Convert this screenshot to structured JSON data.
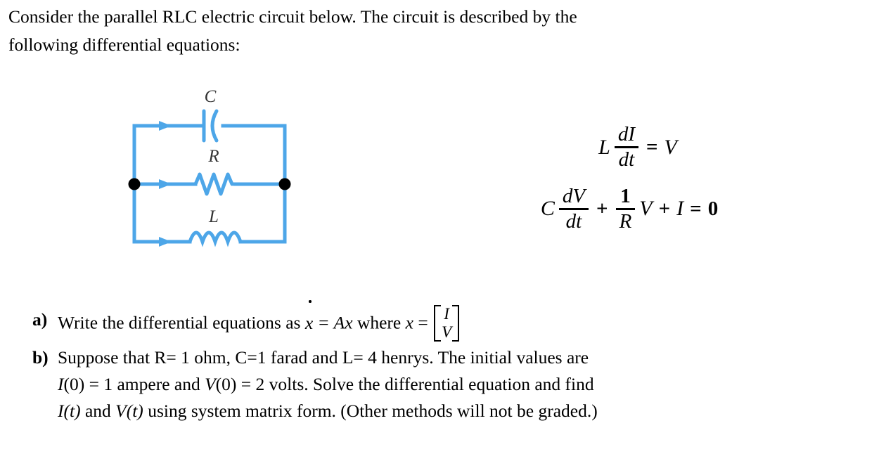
{
  "intro": {
    "line1": "Consider the parallel RLC electric circuit below. The circuit is described by the",
    "line2": "following differential equations:"
  },
  "circuit": {
    "title": "parallel-rlc-circuit",
    "wire_color": "#4da6e8",
    "node_color": "#000000",
    "components": [
      {
        "id": "capacitor",
        "label": "C",
        "branch": "top"
      },
      {
        "id": "resistor",
        "label": "R",
        "branch": "middle"
      },
      {
        "id": "inductor",
        "label": "L",
        "branch": "bottom"
      }
    ],
    "labels": {
      "capacitor": "C",
      "resistor": "R",
      "inductor": "L"
    },
    "current_arrows": 3,
    "junction_dots": 2
  },
  "equations": {
    "eq1": {
      "lhs_coefficient": "L",
      "numerator": "dI",
      "denominator": "dt",
      "relation": "=",
      "rhs": "V"
    },
    "eq2": {
      "term1_coefficient": "C",
      "term1_numerator": "dV",
      "term1_denominator": "dt",
      "plus1": "+",
      "term2_numerator": "1",
      "term2_denominator": "R",
      "term2_variable": "V",
      "plus2": "+",
      "term3": "I",
      "relation": "=",
      "rhs": "0"
    }
  },
  "questions": [
    {
      "marker": "a)",
      "text_before": "Write the differential equations as",
      "xdot": "x",
      "equals_ax": "= Ax",
      "text_mid": "where",
      "x_var": "x",
      "equals": "=",
      "matrix_top": "I",
      "matrix_bottom": "V"
    },
    {
      "marker": "b)",
      "line1": "Suppose that R= 1 ohm, C=1 farad and L= 4 henrys. The initial values are",
      "line2_a": "I",
      "line2_b": "(0)",
      "line2_c": "= 1 ampere and",
      "line2_d": "V",
      "line2_e": "(0)",
      "line2_f": "= 2 volts. Solve the differential equation and find",
      "line3_a": "I",
      "line3_b": "(t)",
      "line3_c": "and",
      "line3_d": "V",
      "line3_e": "(t)",
      "line3_f": "using system matrix form. (Other methods will not be graded.)"
    }
  ]
}
